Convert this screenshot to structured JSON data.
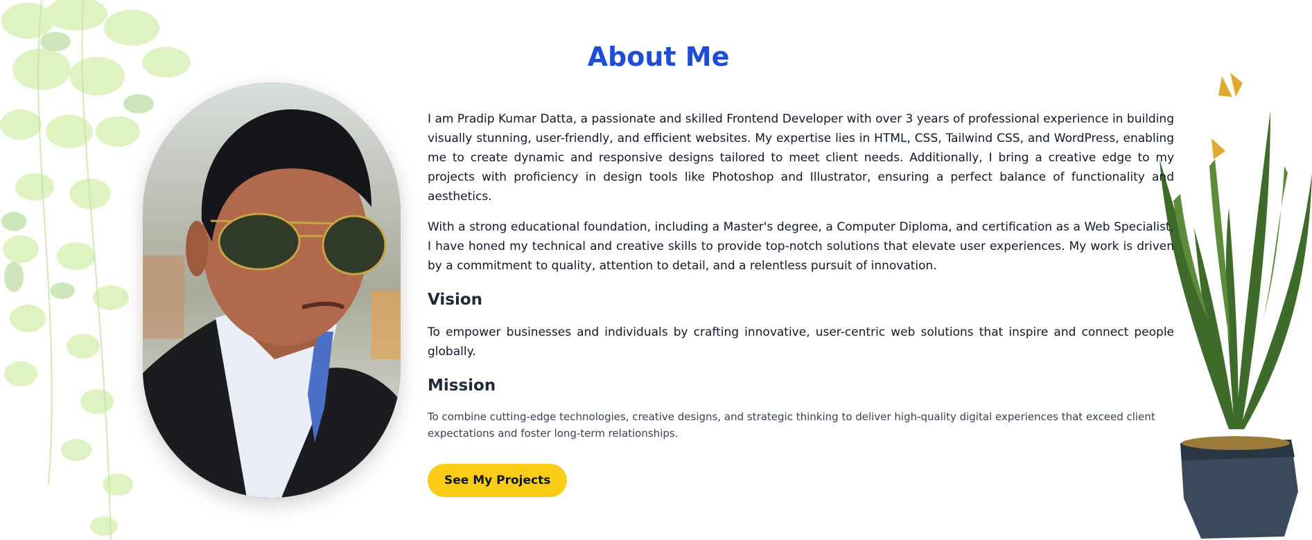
{
  "about": {
    "title": "About Me",
    "intro": "I am Pradip Kumar Datta, a passionate and skilled Frontend Developer with over 3 years of professional experience in building visually stunning, user-friendly, and efficient websites. My expertise lies in HTML, CSS, Tailwind CSS, and WordPress, enabling me to create dynamic and responsive designs tailored to meet client needs. Additionally, I bring a creative edge to my projects with proficiency in design tools like Photoshop and Illustrator, ensuring a perfect balance of functionality and aesthetics.",
    "education": "With a strong educational foundation, including a Master's degree, a Computer Diploma, and certification as a Web Specialist, I have honed my technical and creative skills to provide top-notch solutions that elevate user experiences. My work is driven by a commitment to quality, attention to detail, and a relentless pursuit of innovation.",
    "vision_heading": "Vision",
    "vision_text": "To empower businesses and individuals by crafting innovative, user-centric web solutions that inspire and connect people globally.",
    "mission_heading": "Mission",
    "mission_text": "To combine cutting-edge technologies, creative designs, and strategic thinking to deliver high-quality digital experiences that exceed client expectations and foster long-term relationships.",
    "cta_label": "See My Projects"
  },
  "colors": {
    "title": "#1d4ed8",
    "button": "#facc15",
    "text": "#111827"
  },
  "icons": {
    "left_decoration": "hanging-vine-icon",
    "right_decoration": "potted-plant-icon",
    "portrait": "profile-photo"
  }
}
